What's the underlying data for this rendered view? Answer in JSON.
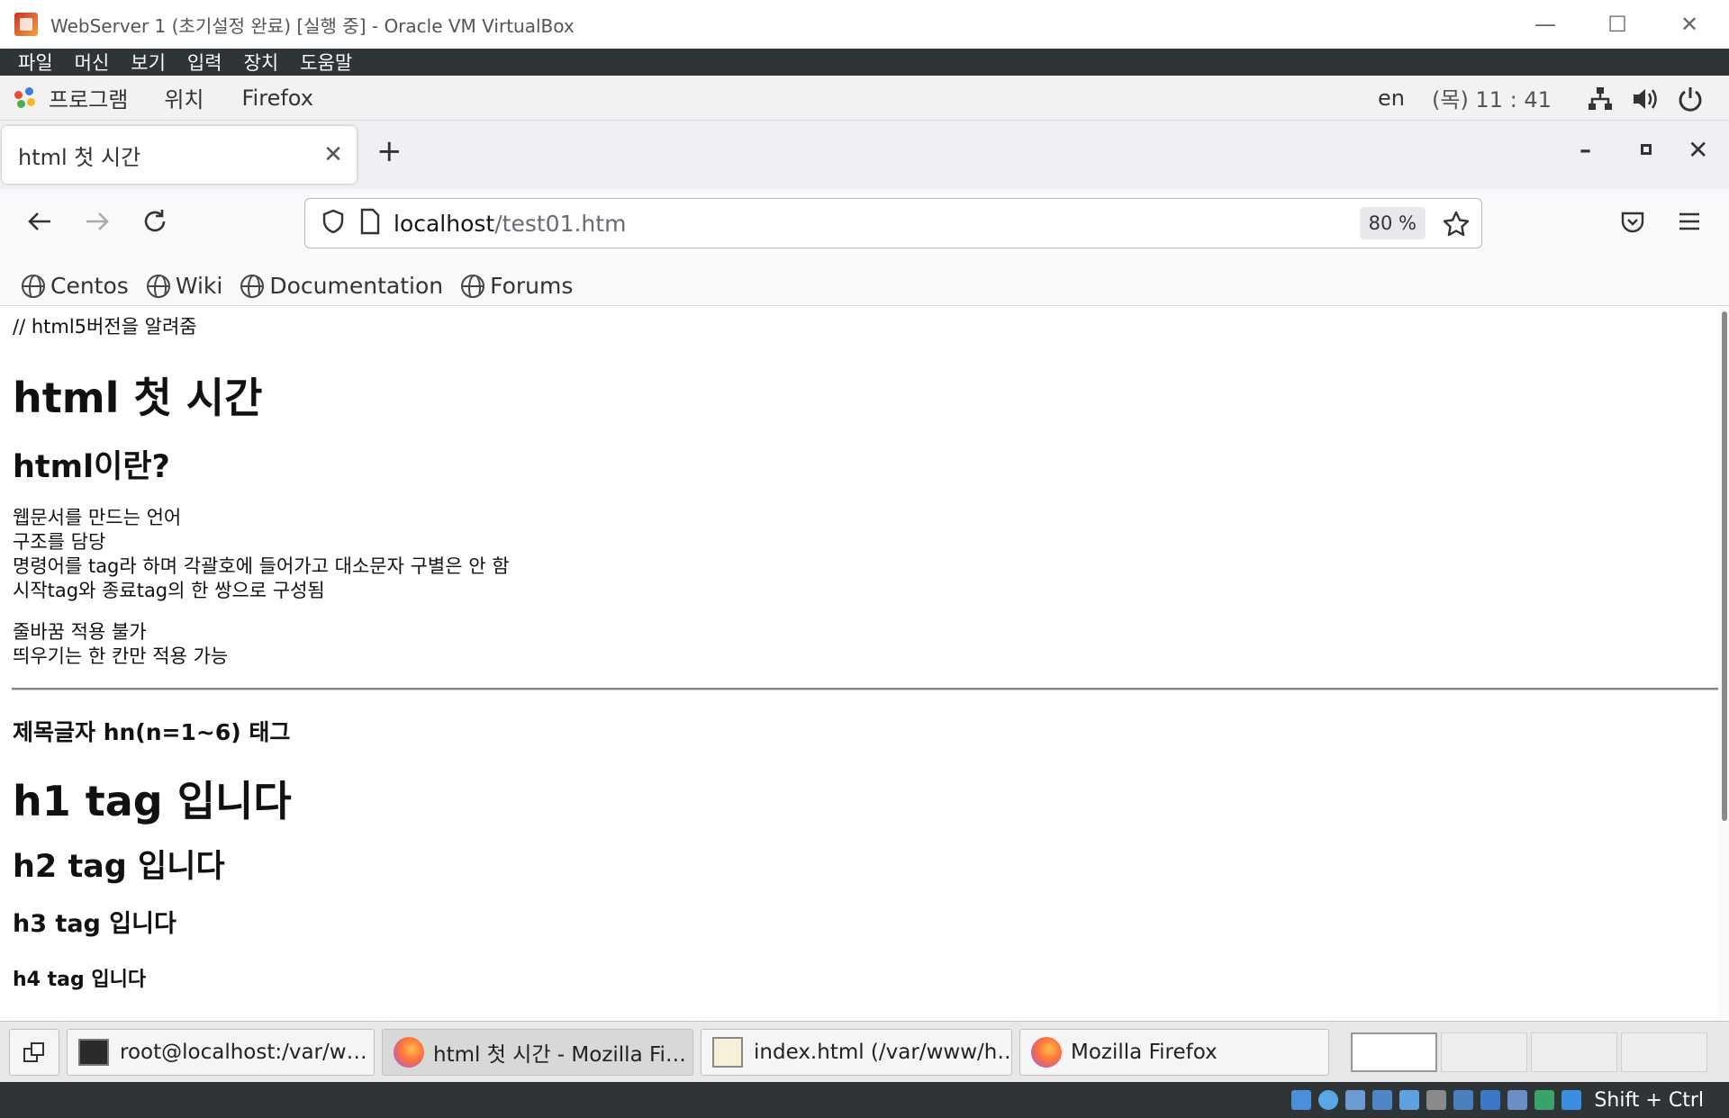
{
  "window": {
    "title": "WebServer 1 (초기설정 완료) [실행 중] - Oracle VM VirtualBox",
    "menu": [
      "파일",
      "머신",
      "보기",
      "입력",
      "장치",
      "도움말"
    ]
  },
  "gnome_panel": {
    "applications": "프로그램",
    "places": "위치",
    "active_app": "Firefox",
    "lang": "en",
    "clock": "(목) 11 : 41"
  },
  "firefox": {
    "tab_title": "html 첫 시간",
    "new_tab": "+",
    "url_host": "localhost",
    "url_path": "/test01.htm",
    "zoom": "80 %",
    "bookmarks": [
      "Centos",
      "Wiki",
      "Documentation",
      "Forums"
    ]
  },
  "page": {
    "comment": "// html5버전을 알려줌",
    "h1_title": "html 첫 시간",
    "h2_title": "html이란?",
    "para1": [
      "웹문서를 만드는 언어",
      "구조를 담당",
      "명령어를 tag라 하며 각괄호에 들어가고 대소문자 구별은 안 함",
      "시작tag와 종료tag의 한 쌍으로 구성됨"
    ],
    "para2": [
      "줄바꿈 적용 불가",
      "띄우기는 한 칸만 적용 가능"
    ],
    "heading_section": "제목글자 hn(n=1~6) 태그",
    "h1_tag": "h1 tag 입니다",
    "h2_tag": "h2 tag 입니다",
    "h3_tag": "h3 tag 입니다",
    "h4_tag": "h4 tag 입니다"
  },
  "taskbar": {
    "items": [
      "root@localhost:/var/w…",
      "html 첫 시간 - Mozilla Fi…",
      "index.html (/var/www/h…",
      "Mozilla Firefox"
    ]
  },
  "vbox_status": {
    "hostkey": "Shift + Ctrl"
  }
}
